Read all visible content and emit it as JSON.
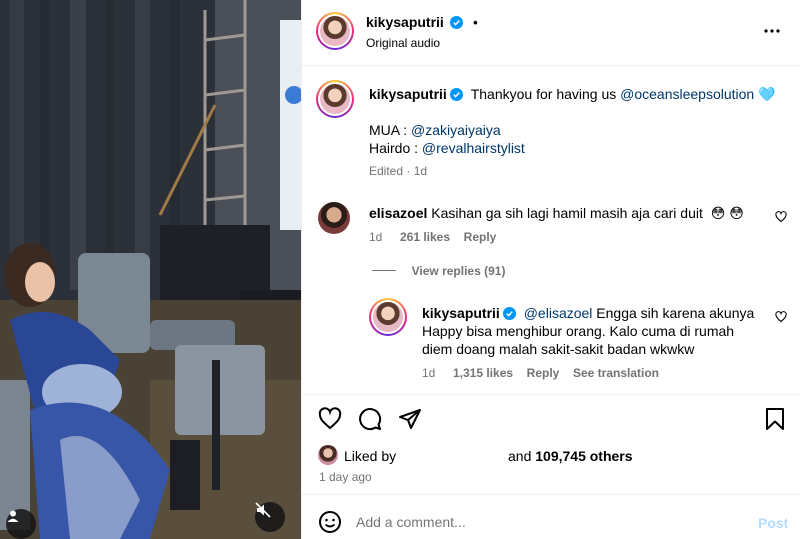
{
  "post": {
    "username": "kikysaputrii",
    "follow_dot": "•",
    "audio": "Original audio",
    "more_icon": "more-horizontal-icon"
  },
  "caption": {
    "username": "kikysaputrii",
    "text_prefix": "Thankyou for having us ",
    "mention_host": "@oceansleepsolution",
    "emoji": "🩵",
    "mua_label": "MUA : ",
    "mua_mention": "@zakiyaiyaiya",
    "hairdo_label": "Hairdo : ",
    "hairdo_mention": "@revalhairstylist",
    "edited": "Edited",
    "separator": "·",
    "age": "1d"
  },
  "comments": [
    {
      "username": "elisazoel",
      "text": "Kasihan ga sih lagi hamil masih aja cari duit",
      "emojis": "😳 😳",
      "age": "1d",
      "likes": "261 likes",
      "reply": "Reply"
    }
  ],
  "view_replies": "View replies (91)",
  "reply": {
    "username": "kikysaputrii",
    "mention": "@elisazoel",
    "line1": " Engga sih karena akunya",
    "line2": "Happy bisa menghibur orang. Kalo cuma di rumah",
    "line3": "diem doang malah sakit-sakit badan wkwkw",
    "age": "1d",
    "likes": "1,315 likes",
    "reply_label": "Reply",
    "translation": "See translation"
  },
  "likes": {
    "liked_by": "Liked by",
    "and_label": "and",
    "count": "109,745 others",
    "time": "1 day ago"
  },
  "composer": {
    "placeholder": "Add a comment...",
    "post_label": "Post"
  },
  "colors": {
    "link": "#00376b",
    "muted": "#737373",
    "verified": "#0095f6",
    "post_disabled": "#b3dbff"
  }
}
